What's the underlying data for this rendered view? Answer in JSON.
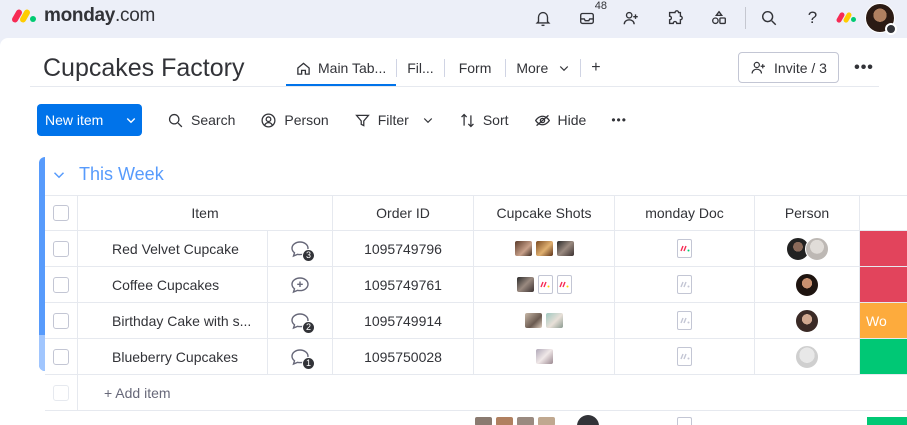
{
  "app": {
    "brand_bold": "monday",
    "brand_suffix": ".com"
  },
  "topbar": {
    "icons": [
      "bell-icon",
      "inbox-icon",
      "invite-members-icon",
      "apps-icon",
      "templates-icon",
      "search-icon",
      "help-icon"
    ],
    "inbox_badge": "48",
    "help_label": "?"
  },
  "board": {
    "title": "Cupcakes Factory",
    "tabs": [
      {
        "label": "Main Tab..."
      },
      {
        "label": "Fil..."
      },
      {
        "label": "Form"
      },
      {
        "label": "More"
      },
      {
        "label": "+"
      }
    ],
    "invite_label": "Invite / 3",
    "more_label": "•••"
  },
  "toolbar": {
    "new_item": "New item",
    "search": "Search",
    "person": "Person",
    "filter": "Filter",
    "sort": "Sort",
    "hide": "Hide",
    "more": "•••"
  },
  "group": {
    "title": "This Week",
    "color": "#579bfc",
    "columns": {
      "item": "Item",
      "order_id": "Order ID",
      "shots": "Cupcake Shots",
      "doc": "monday Doc",
      "person": "Person"
    },
    "rows": [
      {
        "name": "Red Velvet Cupcake",
        "updates": "3",
        "order_id": "1095749796",
        "status_label": ""
      },
      {
        "name": "Coffee Cupcakes",
        "updates": "",
        "order_id": "1095749761",
        "status_label": ""
      },
      {
        "name": "Birthday Cake with s...",
        "updates": "2",
        "order_id": "1095749914",
        "status_label": "Wo"
      },
      {
        "name": "Blueberry Cupcakes",
        "updates": "1",
        "order_id": "1095750028",
        "status_label": ""
      }
    ],
    "add_item": "+ Add item"
  },
  "colors": {
    "primary": "#0073ea",
    "status_red": "#e2445c",
    "status_orange": "#fdab3d",
    "status_green": "#00c875"
  }
}
